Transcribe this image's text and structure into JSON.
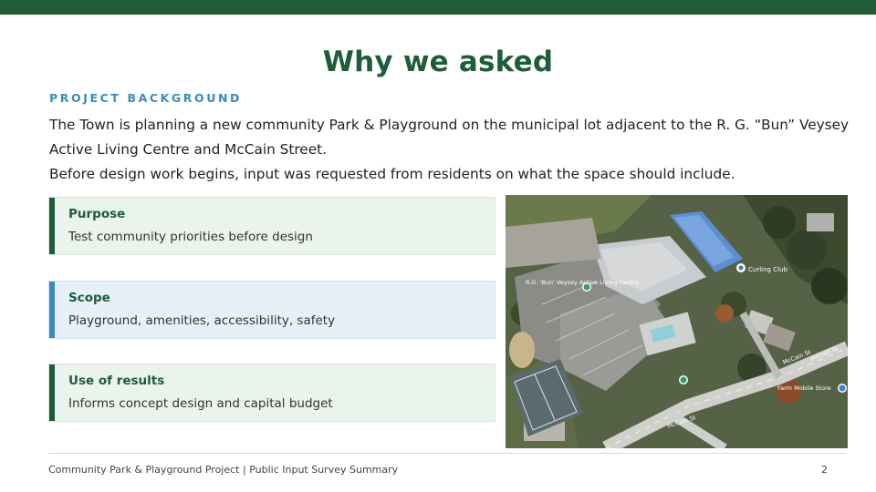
{
  "slide": {
    "title": "Why we asked",
    "section_label": "PROJECT BACKGROUND",
    "intro_lines": [
      "The Town is planning a new community Park & Playground on the municipal lot adjacent to the R. G. “Bun” Veysey",
      "Active Living Centre and McCain Street.",
      "Before design work begins, input was requested from residents on what the space should include."
    ],
    "cards": [
      {
        "title": "Purpose",
        "description": "Test community priorities before design",
        "accent": "#1e5c3a"
      },
      {
        "title": "Scope",
        "description": "Playground, amenities, accessibility, safety",
        "accent": "#3a8bbd"
      },
      {
        "title": "Use of results",
        "description": "Informs concept design and capital budget",
        "accent": "#1e5c3a"
      }
    ]
  },
  "map": {
    "labels": {
      "centre": "R.G. 'Bun' Veysey Active Living Centre",
      "curling": "Curling Club",
      "street_a": "McCain St",
      "street_b": "McCain St",
      "street_c": "McCain St",
      "farm": "Farm Mobile Store"
    },
    "pin_icons": [
      "location-pin-icon",
      "location-pin-icon",
      "location-pin-icon",
      "location-pin-icon"
    ]
  },
  "footer": {
    "text": "Community Park & Playground Project  |  Public Input Survey Summary",
    "page_number": "2"
  },
  "colors": {
    "brand_green": "#1e5c3a",
    "accent_blue": "#3a8bbd",
    "card_green_bg": "#eaf3ec",
    "card_blue_bg": "#e6f0f8"
  }
}
